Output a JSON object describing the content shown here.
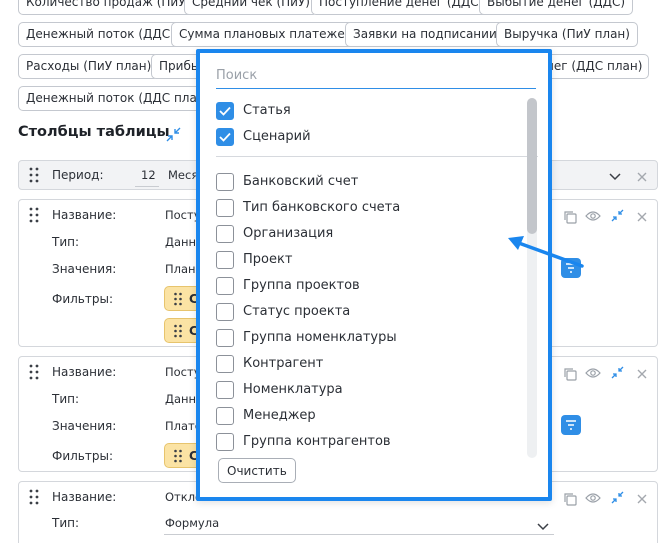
{
  "chips": {
    "sales_count": "Количество продаж (ПиУ)",
    "avg_check": "Средний чек (ПиУ)",
    "cash_in": "Поступление денег (ДДС)",
    "cash_out": "Выбытие денег (ДДС)",
    "cash_flow": "Денежный поток (ДДС)",
    "planned_payments": "Сумма плановых платежей",
    "requests_signing": "Заявки на подписании",
    "revenue_plan": "Выручка (ПиУ план)",
    "expenses_plan": "Расходы (ПиУ план)",
    "profit_partial": "Прибы",
    "money_plan_partial": "нег (ДДС план)",
    "cash_flow_plan": "Денежный поток (ДДС план)"
  },
  "section": {
    "title": "Столбцы таблицы"
  },
  "period_row": {
    "label": "Период:",
    "count": "12",
    "unit_partial": "Меся"
  },
  "columns": [
    {
      "name_label": "Название:",
      "name_value": "Посту",
      "type_label": "Тип:",
      "type_value": "Данн",
      "values_label": "Значения:",
      "values_value": "План",
      "filters_label": "Фильтры:",
      "filter_chips": [
        "С",
        "С"
      ]
    },
    {
      "name_label": "Название:",
      "name_value": "Посту",
      "type_label": "Тип:",
      "type_value": "Данн",
      "values_label": "Значения:",
      "values_value": "Плате",
      "filters_label": "Фильтры:",
      "filter_chips": [
        "С"
      ]
    },
    {
      "name_label": "Название:",
      "name_value": "Отклонение",
      "type_label": "Тип:",
      "type_value": "Формула"
    }
  ],
  "dropdown": {
    "search_placeholder": "Поиск",
    "checked_options": [
      "Статья",
      "Сценарий"
    ],
    "options": [
      "Банковский счет",
      "Тип банковского счета",
      "Организация",
      "Проект",
      "Группа проектов",
      "Статус проекта",
      "Группа номенклатуры",
      "Контрагент",
      "Номенклатура",
      "Менеджер",
      "Группа контрагентов"
    ],
    "clear_label": "Очистить"
  },
  "colors": {
    "accent": "#2f8ee6",
    "highlight_border": "#1a86ee",
    "filter_chip": "#fbe3a4",
    "annotation_arrow": "#1a86ee"
  }
}
